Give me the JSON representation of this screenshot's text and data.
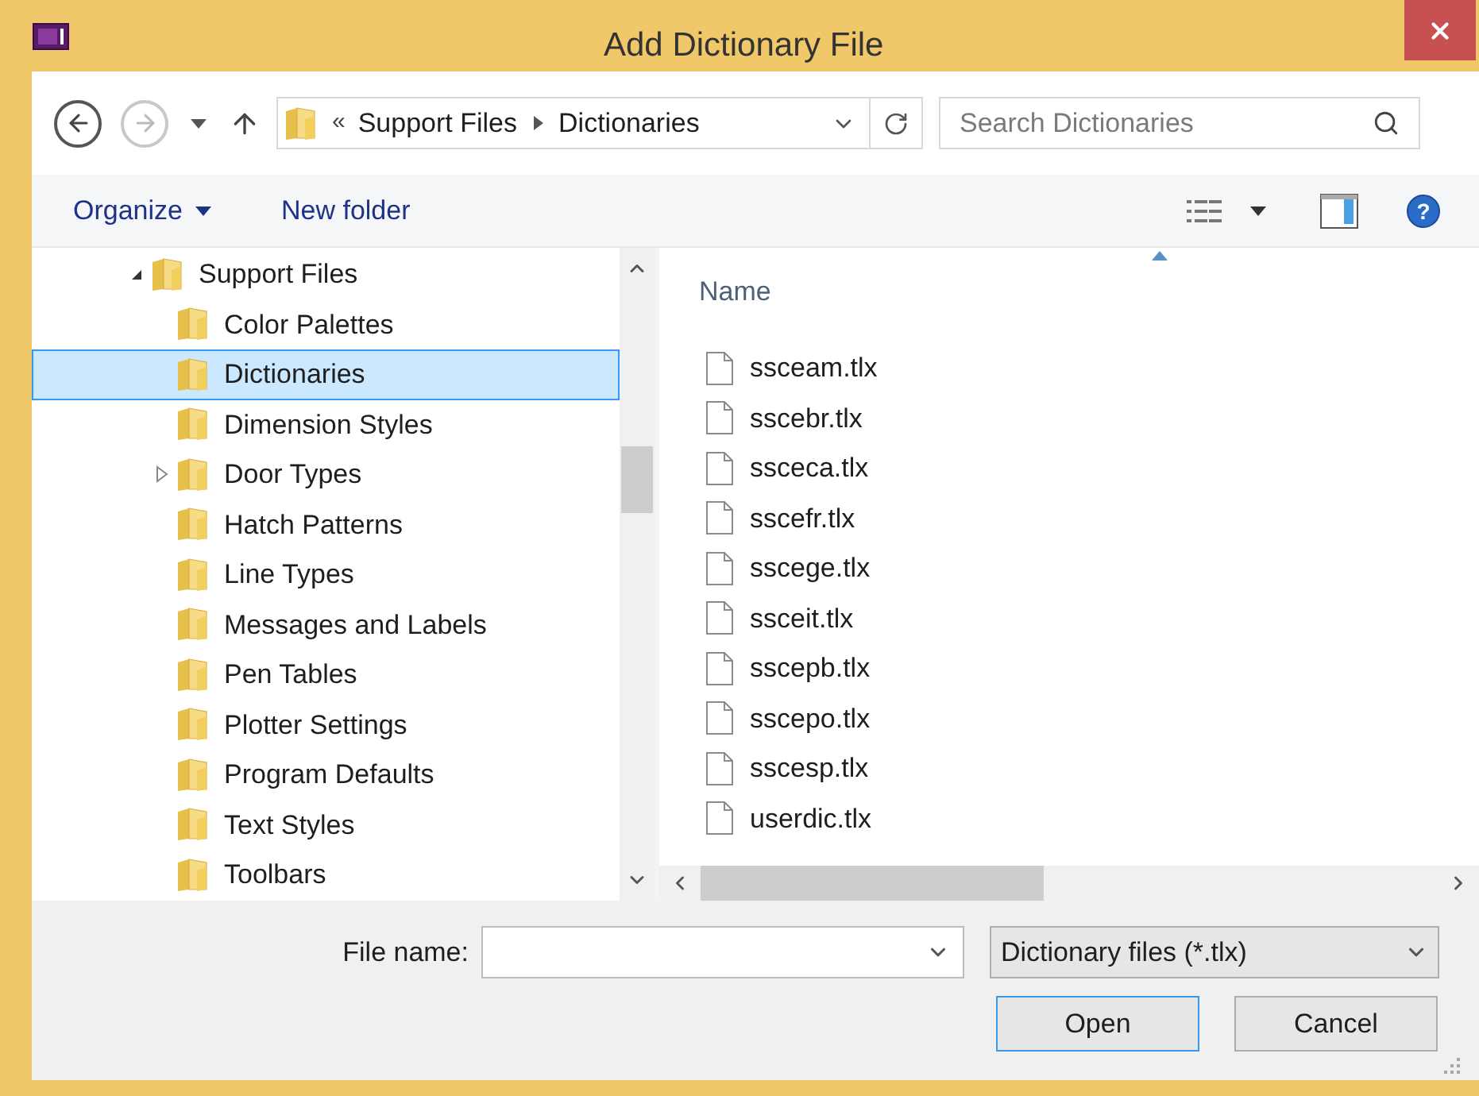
{
  "window": {
    "title": "Add Dictionary File"
  },
  "address_bar": {
    "overflow": "«",
    "path": [
      "Support Files",
      "Dictionaries"
    ]
  },
  "search": {
    "placeholder": "Search Dictionaries"
  },
  "command_bar": {
    "items": [
      {
        "label": "Organize",
        "dropdown": true
      },
      {
        "label": "New folder",
        "dropdown": false
      }
    ],
    "help": "?"
  },
  "tree": [
    {
      "label": "Support Files",
      "expanded": true,
      "selected": false,
      "children": [
        {
          "label": "Color Palettes",
          "selected": false
        },
        {
          "label": "Dictionaries",
          "selected": true
        },
        {
          "label": "Dimension Styles",
          "selected": false
        },
        {
          "label": "Door Types",
          "expanded": false,
          "selected": false
        },
        {
          "label": "Hatch Patterns",
          "selected": false
        },
        {
          "label": "Line Types",
          "selected": false
        },
        {
          "label": "Messages and Labels",
          "selected": false
        },
        {
          "label": "Pen Tables",
          "selected": false
        },
        {
          "label": "Plotter Settings",
          "selected": false
        },
        {
          "label": "Program Defaults",
          "selected": false
        },
        {
          "label": "Text Styles",
          "selected": false
        },
        {
          "label": "Toolbars",
          "selected": false
        }
      ]
    }
  ],
  "file_list": {
    "columns": [
      "Name"
    ],
    "rows": [
      "ssceam.tlx",
      "sscebr.tlx",
      "ssceca.tlx",
      "sscefr.tlx",
      "sscege.tlx",
      "ssceit.tlx",
      "sscepb.tlx",
      "sscepo.tlx",
      "sscesp.tlx",
      "userdic.tlx"
    ]
  },
  "file_name": {
    "label": "File name:"
  },
  "file_type": {
    "value": "Dictionary files (*.tlx)"
  },
  "buttons": [
    {
      "label": "Open",
      "default": true
    },
    {
      "label": "Cancel",
      "default": false
    }
  ]
}
